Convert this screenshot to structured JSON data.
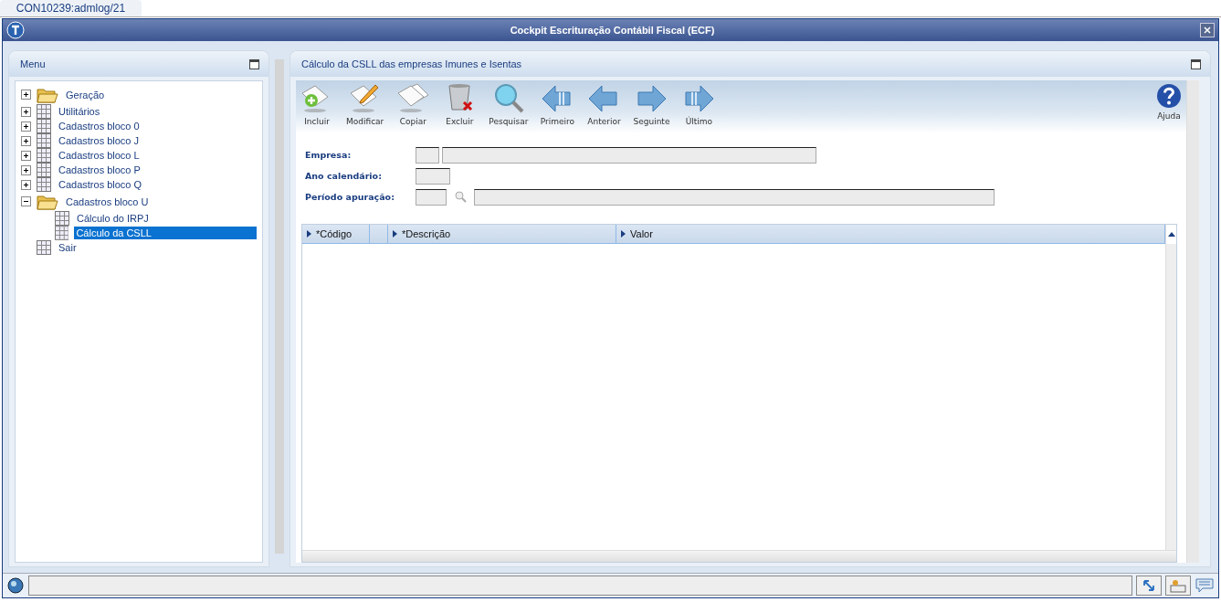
{
  "session_tab": {
    "label": "CON10239:admlog/21",
    "selected": true
  },
  "window": {
    "title": "Cockpit Escrituração Contábil Fiscal (ECF)"
  },
  "menu": {
    "title": "Menu",
    "tree": [
      {
        "label": "Geração",
        "kind": "folder",
        "expanded": false,
        "selected": false
      },
      {
        "label": "Utilitários",
        "kind": "table",
        "expanded": false,
        "selected": false
      },
      {
        "label": "Cadastros bloco 0",
        "kind": "table",
        "expanded": false,
        "selected": false
      },
      {
        "label": "Cadastros bloco J",
        "kind": "table",
        "expanded": false,
        "selected": false
      },
      {
        "label": "Cadastros bloco L",
        "kind": "table",
        "expanded": false,
        "selected": false
      },
      {
        "label": "Cadastros bloco P",
        "kind": "table",
        "expanded": false,
        "selected": false
      },
      {
        "label": "Cadastros bloco Q",
        "kind": "table",
        "expanded": false,
        "selected": false
      },
      {
        "label": "Cadastros bloco U",
        "kind": "folder",
        "expanded": true,
        "selected": false,
        "children": [
          {
            "label": "Cálculo do IRPJ",
            "kind": "table",
            "selected": false
          },
          {
            "label": "Cálculo da CSLL",
            "kind": "table",
            "selected": true
          }
        ]
      },
      {
        "label": "Sair",
        "kind": "table",
        "selected": false
      }
    ]
  },
  "content": {
    "title": "Cálculo da CSLL das empresas Imunes e Isentas",
    "toolbar": [
      {
        "label": "Incluir",
        "kind": "add"
      },
      {
        "label": "Modificar",
        "kind": "edit"
      },
      {
        "label": "Copiar",
        "kind": "copy"
      },
      {
        "label": "Excluir",
        "kind": "delete"
      },
      {
        "label": "Pesquisar",
        "kind": "search"
      },
      {
        "label": "Primeiro",
        "kind": "first"
      },
      {
        "label": "Anterior",
        "kind": "prev"
      },
      {
        "label": "Seguinte",
        "kind": "next"
      },
      {
        "label": "Último",
        "kind": "last"
      }
    ],
    "help": {
      "label": "Ajuda"
    },
    "fields": [
      {
        "label": "Empresa:",
        "kind": "code_name"
      },
      {
        "label": "Ano calendário:",
        "kind": "short"
      },
      {
        "label": "Período apuração:",
        "kind": "code_lookup_name"
      }
    ],
    "grid": {
      "columns": [
        {
          "label": "*Código",
          "kind": "text"
        },
        {
          "kind": "spacer"
        },
        {
          "label": "*Descrição",
          "kind": "text"
        },
        {
          "label": "Valor",
          "kind": "text"
        }
      ]
    }
  }
}
